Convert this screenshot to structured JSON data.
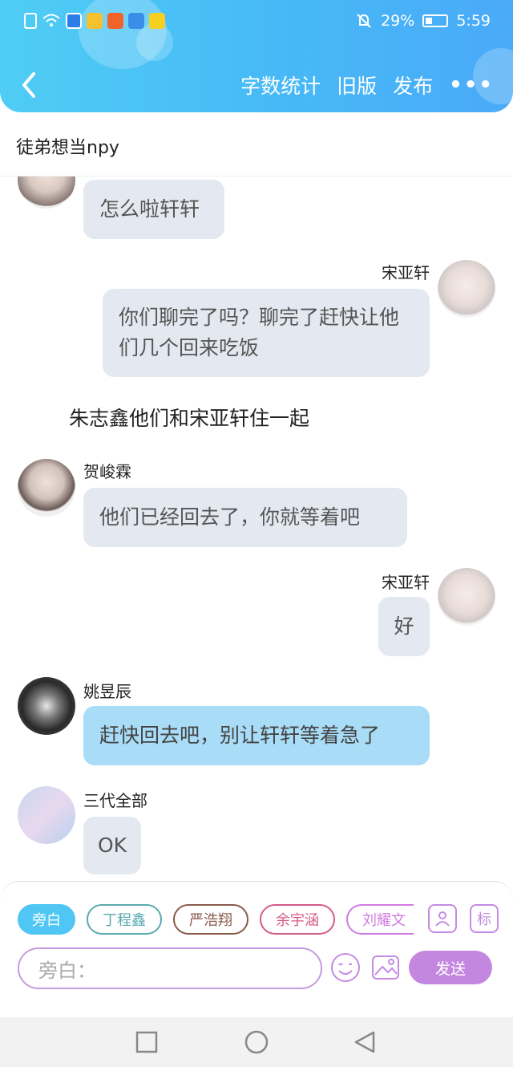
{
  "status": {
    "battery": "29%",
    "time": "5:59"
  },
  "nav": {
    "word_count": "字数统计",
    "old_version": "旧版",
    "publish": "发布",
    "more": "•••"
  },
  "title": "徒弟想当npy",
  "messages": [
    {
      "text": "怎么啦轩轩"
    },
    {
      "name": "宋亚轩",
      "text": "你们聊完了吗？聊完了赶快让他们几个回来吃饭"
    },
    {
      "narration": "朱志鑫他们和宋亚轩住一起"
    },
    {
      "name": "贺峻霖",
      "text": "他们已经回去了，你就等着吧"
    },
    {
      "name": "宋亚轩",
      "text": "好"
    },
    {
      "name": "姚昱辰",
      "text": "赶快回去吧，别让轩轩等着急了"
    },
    {
      "name": "三代全部",
      "text": "OK"
    }
  ],
  "chips": [
    {
      "label": "旁白",
      "color": "#4fc6f3"
    },
    {
      "label": "丁程鑫",
      "color": "#5aaab0"
    },
    {
      "label": "严浩翔",
      "color": "#8a5a4a"
    },
    {
      "label": "余宇涵",
      "color": "#d65a8a"
    },
    {
      "label": "刘耀文",
      "color": "#d07ae0"
    }
  ],
  "tag_icon_label": "标",
  "input": {
    "placeholder": "旁白："
  },
  "send_label": "发送",
  "colors": {
    "accent": "#4fc6f3",
    "purple": "#c487e0",
    "bubble_gray": "#e4e9f1",
    "bubble_blue": "#a9dcf7"
  }
}
